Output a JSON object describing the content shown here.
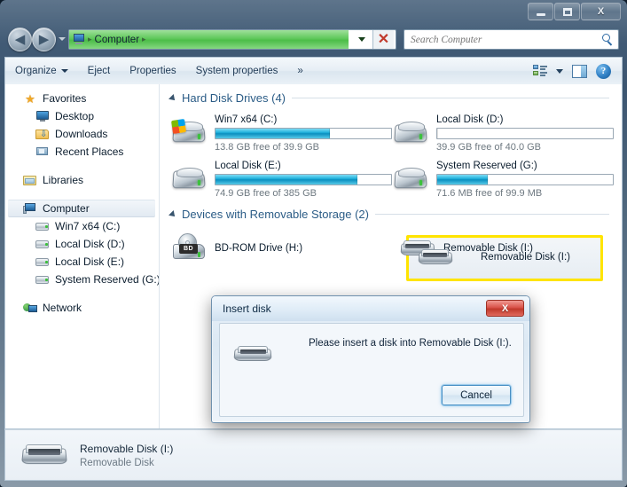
{
  "window": {
    "controls": {
      "minimize": "–",
      "maximize": "□",
      "close": "X"
    }
  },
  "navbar": {
    "back_icon": "◀",
    "forward_icon": "▶",
    "address": {
      "root_icon": "computer-icon",
      "crumb": "Computer",
      "sep": "▸",
      "progress_percent": 85,
      "stop_label": "✕"
    },
    "search": {
      "placeholder": "Search Computer",
      "value": ""
    }
  },
  "toolbar": {
    "items": [
      {
        "label": "Organize",
        "caret": true
      },
      {
        "label": "Eject",
        "caret": false
      },
      {
        "label": "Properties",
        "caret": false
      },
      {
        "label": "System properties",
        "caret": false
      },
      {
        "label": "»",
        "caret": false
      }
    ],
    "help_glyph": "?"
  },
  "sidebar": {
    "groups": [
      {
        "header": {
          "label": "Favorites",
          "icon": "star-icon"
        },
        "items": [
          {
            "label": "Desktop",
            "icon": "desktop-icon"
          },
          {
            "label": "Downloads",
            "icon": "downloads-icon"
          },
          {
            "label": "Recent Places",
            "icon": "recent-places-icon"
          }
        ]
      },
      {
        "header": {
          "label": "Libraries",
          "icon": "libraries-icon"
        },
        "items": []
      },
      {
        "header": {
          "label": "Computer",
          "icon": "computer-icon",
          "selected": true
        },
        "items": [
          {
            "label": "Win7 x64 (C:)",
            "icon": "windows-drive-icon"
          },
          {
            "label": "Local Disk (D:)",
            "icon": "drive-icon"
          },
          {
            "label": "Local Disk (E:)",
            "icon": "drive-icon"
          },
          {
            "label": "System Reserved (G:)",
            "icon": "drive-icon"
          }
        ]
      },
      {
        "header": {
          "label": "Network",
          "icon": "network-icon"
        },
        "items": []
      }
    ]
  },
  "main": {
    "groups": [
      {
        "title": "Hard Disk Drives (4)",
        "drives": [
          {
            "name": "Win7 x64 (C:)",
            "sub": "13.8 GB free of 39.9 GB",
            "used_percent": 65,
            "icon": "windows-hdd-icon",
            "bar": true
          },
          {
            "name": "Local Disk (D:)",
            "sub": "39.9 GB free of 40.0 GB",
            "used_percent": 0,
            "icon": "hdd-icon",
            "bar": true
          },
          {
            "name": "Local Disk (E:)",
            "sub": "74.9 GB free of 385 GB",
            "used_percent": 81,
            "icon": "hdd-icon",
            "bar": true
          },
          {
            "name": "System Reserved (G:)",
            "sub": "71.6 MB free of 99.9 MB",
            "used_percent": 29,
            "icon": "hdd-icon",
            "bar": true
          }
        ]
      },
      {
        "title": "Devices with Removable Storage (2)",
        "drives": [
          {
            "name": "BD-ROM Drive (H:)",
            "sub": "",
            "icon": "bd-rom-icon",
            "bar": false
          },
          {
            "name": "Removable Disk (I:)",
            "sub": "",
            "icon": "removable-disk-icon",
            "bar": false,
            "highlighted": true
          }
        ]
      }
    ],
    "highlight_color": "#ffe400"
  },
  "details": {
    "name": "Removable Disk (I:)",
    "type": "Removable Disk",
    "icon": "removable-disk-icon"
  },
  "dialog": {
    "title": "Insert disk",
    "close_label": "X",
    "message": "Please insert a disk into Removable Disk (I:).",
    "icon": "removable-disk-icon",
    "cancel_label": "Cancel"
  }
}
